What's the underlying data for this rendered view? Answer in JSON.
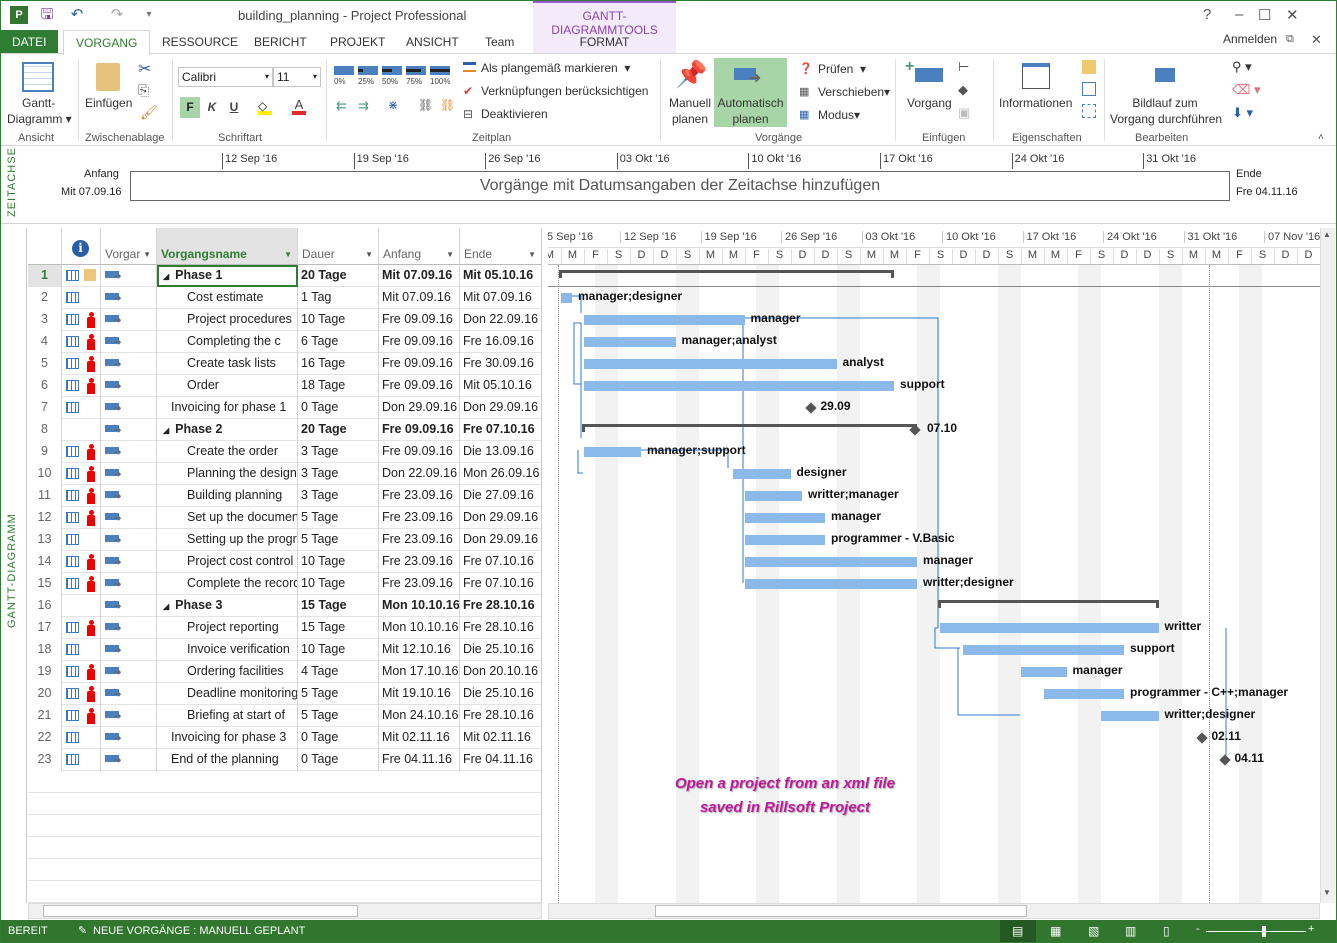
{
  "window": {
    "title": "building_planning - Project Professional",
    "context_tools": "GANTT-DIAGRAMMTOOLS",
    "context_tab": "FORMAT",
    "signin": "Anmelden",
    "help": "?",
    "minimize": "–",
    "maximize": "☐",
    "close": "✕"
  },
  "tabs": [
    "DATEI",
    "VORGANG",
    "RESSOURCE",
    "BERICHT",
    "PROJEKT",
    "ANSICHT",
    "Team"
  ],
  "ribbon": {
    "ansicht": {
      "gantt_btn": "Gantt-",
      "gantt_btn2": "Diagramm ▾",
      "label": "Ansicht"
    },
    "clipboard": {
      "paste": "Einfügen",
      "label": "Zwischenablage"
    },
    "font": {
      "name": "Calibri",
      "size": "11",
      "bold": "F",
      "italic": "K",
      "underline": "U",
      "label": "Schriftart"
    },
    "zeitplan": {
      "pcts": [
        "0%",
        "25%",
        "50%",
        "75%",
        "100%"
      ],
      "mark": "Als plangemäß markieren",
      "links": "Verknüpfungen berücksichtigen",
      "deactivate": "Deaktivieren",
      "label": "Zeitplan"
    },
    "vorgaenge": {
      "manual1": "Manuell",
      "manual2": "planen",
      "auto1": "Automatisch",
      "auto2": "planen",
      "check": "Prüfen",
      "move": "Verschieben",
      "mode": "Modus",
      "label": "Vorgänge"
    },
    "einfuegen": {
      "task": "Vorgang",
      "label": "Einfügen"
    },
    "eigenschaften": {
      "info": "Informationen",
      "label": "Eigenschaften"
    },
    "bearbeiten": {
      "scroll1": "Bildlauf zum",
      "scroll2": "Vorgang durchführen",
      "label": "Bearbeiten"
    }
  },
  "timeline": {
    "side_label": "ZEITACHSE",
    "start_label": "Anfang",
    "start_date": "Mit 07.09.16",
    "end_label": "Ende",
    "end_date": "Fre 04.11.16",
    "placeholder": "Vorgänge mit Datumsangaben der Zeitachse hinzufügen",
    "ticks": [
      "12 Sep '16",
      "19 Sep '16",
      "26 Sep '16",
      "03 Okt '16",
      "10 Okt '16",
      "17 Okt '16",
      "24 Okt '16",
      "31 Okt '16"
    ]
  },
  "view_label": "GANTT-DIAGRAMM",
  "table": {
    "columns": [
      "Vorgangsmodus",
      "Vorgangsname",
      "Dauer",
      "Anfang",
      "Ende"
    ],
    "mode_short": "Vorgar",
    "rows": [
      {
        "id": "1",
        "name": "Phase 1",
        "dur": "20 Tage",
        "start": "Mit 07.09.16",
        "end": "Mit 05.10.16",
        "summary": true,
        "indent": 0,
        "cal": true,
        "note": true,
        "res": ""
      },
      {
        "id": "2",
        "name": "Cost estimate",
        "dur": "1 Tag",
        "start": "Mit 07.09.16",
        "end": "Mit 07.09.16",
        "indent": 1,
        "cal": true,
        "res": "manager;designer"
      },
      {
        "id": "3",
        "name": "Project procedures",
        "dur": "10 Tage",
        "start": "Fre 09.09.16",
        "end": "Don 22.09.16",
        "indent": 1,
        "cal": true,
        "person": true,
        "res": "manager"
      },
      {
        "id": "4",
        "name": "Completing the c",
        "dur": "6 Tage",
        "start": "Fre 09.09.16",
        "end": "Fre 16.09.16",
        "indent": 1,
        "cal": true,
        "person": true,
        "res": "manager;analyst"
      },
      {
        "id": "5",
        "name": "Create task lists",
        "dur": "16 Tage",
        "start": "Fre 09.09.16",
        "end": "Fre 30.09.16",
        "indent": 1,
        "cal": true,
        "person": true,
        "res": "analyst"
      },
      {
        "id": "6",
        "name": "Order",
        "dur": "18 Tage",
        "start": "Fre 09.09.16",
        "end": "Mit 05.10.16",
        "indent": 1,
        "cal": true,
        "person": true,
        "res": "support"
      },
      {
        "id": "7",
        "name": "Invoicing for phase 1",
        "dur": "0 Tage",
        "start": "Don 29.09.16",
        "end": "Don 29.09.16",
        "indent": 0.5,
        "cal": true,
        "milestone": true,
        "res": "29.09"
      },
      {
        "id": "8",
        "name": "Phase 2",
        "dur": "20 Tage",
        "start": "Fre 09.09.16",
        "end": "Fre 07.10.16",
        "summary": true,
        "indent": 0,
        "res": "07.10"
      },
      {
        "id": "9",
        "name": "Create the order",
        "dur": "3 Tage",
        "start": "Fre 09.09.16",
        "end": "Die 13.09.16",
        "indent": 1,
        "cal": true,
        "person": true,
        "res": "manager;support"
      },
      {
        "id": "10",
        "name": "Planning the design",
        "dur": "3 Tage",
        "start": "Don 22.09.16",
        "end": "Mon 26.09.16",
        "indent": 1,
        "cal": true,
        "person": true,
        "res": "designer"
      },
      {
        "id": "11",
        "name": "Building planning",
        "dur": "3 Tage",
        "start": "Fre 23.09.16",
        "end": "Die 27.09.16",
        "indent": 1,
        "cal": true,
        "person": true,
        "res": "writter;manager"
      },
      {
        "id": "12",
        "name": "Set up the documents",
        "dur": "5 Tage",
        "start": "Fre 23.09.16",
        "end": "Don 29.09.16",
        "indent": 1,
        "cal": true,
        "person": true,
        "res": "manager"
      },
      {
        "id": "13",
        "name": "Setting up the program",
        "dur": "5 Tage",
        "start": "Fre 23.09.16",
        "end": "Don 29.09.16",
        "indent": 1,
        "cal": true,
        "res": "programmer - V.Basic"
      },
      {
        "id": "14",
        "name": "Project cost control",
        "dur": "10 Tage",
        "start": "Fre 23.09.16",
        "end": "Fre 07.10.16",
        "indent": 1,
        "cal": true,
        "person": true,
        "res": "manager"
      },
      {
        "id": "15",
        "name": "Complete the records",
        "dur": "10 Tage",
        "start": "Fre 23.09.16",
        "end": "Fre 07.10.16",
        "indent": 1,
        "cal": true,
        "person": true,
        "res": "writter;designer"
      },
      {
        "id": "16",
        "name": "Phase 3",
        "dur": "15 Tage",
        "start": "Mon 10.10.16",
        "end": "Fre 28.10.16",
        "summary": true,
        "indent": 0,
        "res": ""
      },
      {
        "id": "17",
        "name": "Project reporting",
        "dur": "15 Tage",
        "start": "Mon 10.10.16",
        "end": "Fre 28.10.16",
        "indent": 1,
        "cal": true,
        "person": true,
        "res": "writter"
      },
      {
        "id": "18",
        "name": "Invoice verification",
        "dur": "10 Tage",
        "start": "Mit 12.10.16",
        "end": "Die 25.10.16",
        "indent": 1,
        "cal": true,
        "res": "support"
      },
      {
        "id": "19",
        "name": "Ordering facilities",
        "dur": "4 Tage",
        "start": "Mon 17.10.16",
        "end": "Don 20.10.16",
        "indent": 1,
        "cal": true,
        "person": true,
        "res": "manager"
      },
      {
        "id": "20",
        "name": "Deadline monitoring",
        "dur": "5 Tage",
        "start": "Mit 19.10.16",
        "end": "Die 25.10.16",
        "indent": 1,
        "cal": true,
        "person": true,
        "res": "programmer - C++;manager"
      },
      {
        "id": "21",
        "name": "Briefing at start of",
        "dur": "5 Tage",
        "start": "Mon 24.10.16",
        "end": "Fre 28.10.16",
        "indent": 1,
        "cal": true,
        "person": true,
        "res": "writter;designer"
      },
      {
        "id": "22",
        "name": "Invoicing for phase 3",
        "dur": "0 Tage",
        "start": "Mit 02.11.16",
        "end": "Mit 02.11.16",
        "indent": 0.5,
        "cal": true,
        "milestone": true,
        "res": "02.11"
      },
      {
        "id": "23",
        "name": "End of the planning",
        "dur": "0 Tage",
        "start": "Fre 04.11.16",
        "end": "Fre 04.11.16",
        "indent": 0.5,
        "cal": true,
        "milestone": true,
        "res": "04.11"
      }
    ]
  },
  "gantt": {
    "weeks": [
      "5 Sep '16",
      "12 Sep '16",
      "19 Sep '16",
      "26 Sep '16",
      "03 Okt '16",
      "10 Okt '16",
      "17 Okt '16",
      "24 Okt '16",
      "31 Okt '16",
      "07 Nov '16"
    ],
    "day_letters": [
      "S",
      "M",
      "D",
      "M",
      "D",
      "F",
      "S"
    ],
    "bar_color": "#8ab9ea",
    "link_color": "#2f7bd1"
  },
  "annotation": {
    "line1": "Open a project from an xml file",
    "line2": "saved in Rillsoft Project"
  },
  "status": {
    "ready": "BEREIT",
    "new_tasks": "NEUE VORGÄNGE : MANUELL GEPLANT"
  },
  "colors": {
    "brand": "#31752f",
    "context": "#8e44ad",
    "annotation": "#c0189a"
  }
}
